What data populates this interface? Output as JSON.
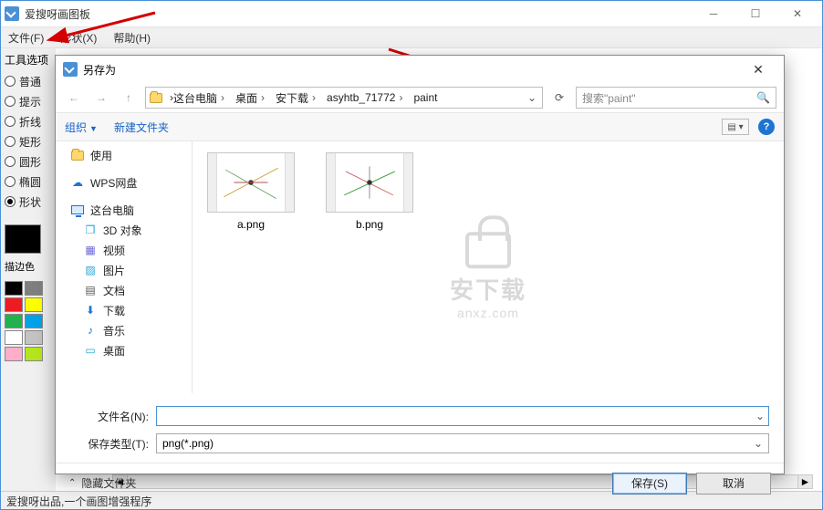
{
  "main": {
    "title": "爱搜呀画图板",
    "menus": {
      "file": "文件(F)",
      "shape": "形状(X)",
      "help": "帮助(H)"
    },
    "toolOptions": "工具选项",
    "shapes": {
      "normal": "普通",
      "hint": "提示",
      "polyline": "折线",
      "rect": "矩形",
      "circle": "圆形",
      "ellipse": "椭圆",
      "shape": "形状"
    },
    "strokeLabel": "描边色",
    "status": "爱搜呀出品,一个画图增强程序"
  },
  "palette": {
    "colors": [
      "#000000",
      "#7f7f7f",
      "#ed1c24",
      "#ffff00",
      "#22b14c",
      "#00a2e8",
      "#ffffff",
      "#c3c3c3",
      "#ffaec9",
      "#b5e61d"
    ]
  },
  "dialog": {
    "title": "另存为",
    "breadcrumbs": [
      "这台电脑",
      "桌面",
      "安下载",
      "asyhtb_71772",
      "paint"
    ],
    "search_placeholder": "搜索\"paint\"",
    "organize": "组织",
    "newfolder": "新建文件夹",
    "tree": {
      "use": "使用",
      "wps": "WPS网盘",
      "thispc": "这台电脑",
      "d3": "3D 对象",
      "video": "视频",
      "pic": "图片",
      "doc": "文档",
      "dl": "下载",
      "music": "音乐",
      "desktop": "桌面"
    },
    "files": {
      "a": "a.png",
      "b": "b.png"
    },
    "fileNameLabel": "文件名(N):",
    "fileNameValue": "",
    "fileTypeLabel": "保存类型(T):",
    "fileTypeValue": "png(*.png)",
    "hideFolders": "隐藏文件夹",
    "save": "保存(S)",
    "cancel": "取消"
  },
  "watermark": {
    "big": "安下载",
    "small": "anxz.com"
  }
}
